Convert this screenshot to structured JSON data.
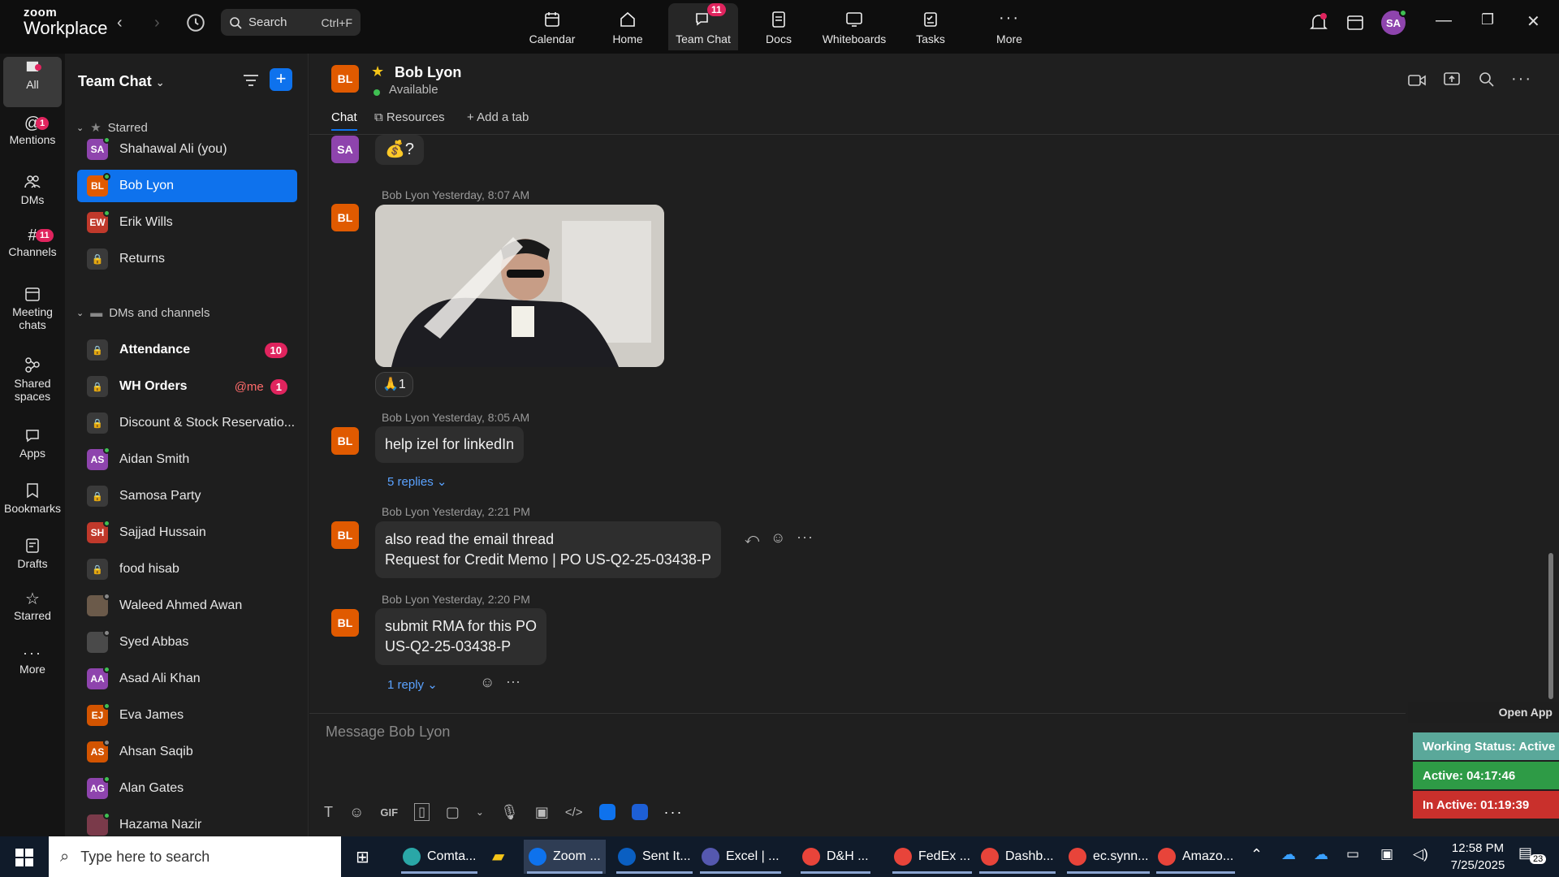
{
  "app": {
    "logo_top": "zoom",
    "logo_bottom": "Workplace",
    "search_label": "Search",
    "search_shortcut": "Ctrl+F"
  },
  "topnav": [
    {
      "label": "Calendar",
      "icon": "calendar-icon"
    },
    {
      "label": "Home",
      "icon": "home-icon"
    },
    {
      "label": "Team Chat",
      "icon": "chat-icon",
      "badge": "11"
    },
    {
      "label": "Docs",
      "icon": "docs-icon"
    },
    {
      "label": "Whiteboards",
      "icon": "whiteboard-icon"
    },
    {
      "label": "Tasks",
      "icon": "tasks-icon"
    },
    {
      "label": "More",
      "icon": "more-icon"
    }
  ],
  "user": {
    "initials": "SA"
  },
  "rail": [
    {
      "label": "All",
      "icon": "chat-bubble-icon"
    },
    {
      "label": "Mentions",
      "icon": "at-icon",
      "badge": "1"
    },
    {
      "label": "DMs",
      "icon": "people-icon"
    },
    {
      "label": "Channels",
      "icon": "hash-icon",
      "badge": "11"
    },
    {
      "label": "Meeting chats",
      "icon": "calendar-icon"
    },
    {
      "label": "Shared spaces",
      "icon": "shared-spaces-icon"
    },
    {
      "label": "Apps",
      "icon": "apps-icon"
    },
    {
      "label": "Bookmarks",
      "icon": "bookmark-icon"
    },
    {
      "label": "Drafts",
      "icon": "drafts-icon"
    },
    {
      "label": "Starred",
      "icon": "star-icon"
    },
    {
      "label": "More",
      "icon": "more-icon"
    }
  ],
  "sidebar": {
    "title": "Team Chat",
    "starred_label": "Starred",
    "dms_label": "DMs and channels",
    "starred": [
      {
        "name": "Shahawal Ali (you)",
        "initials": "SA",
        "color": "#8e44ad"
      },
      {
        "name": "Bob Lyon",
        "initials": "BL",
        "color": "#e05a00"
      },
      {
        "name": "Erik Wills",
        "initials": "EW",
        "color": "#c0392b"
      },
      {
        "name": "Returns",
        "initials": "",
        "color": "#3a3a3a"
      }
    ],
    "channels": [
      {
        "name": "Attendance",
        "count": "10",
        "bold": true
      },
      {
        "name": "WH Orders",
        "mention": "@me",
        "count": "1",
        "bold": true
      },
      {
        "name": "Discount & Stock Reservatio...",
        "count": ""
      },
      {
        "name": "Aidan Smith",
        "initials": "AS",
        "color": "#8e44ad"
      },
      {
        "name": "Samosa Party",
        "count": ""
      },
      {
        "name": "Sajjad Hussain",
        "initials": "SH",
        "color": "#c0392b"
      },
      {
        "name": "food hisab",
        "count": ""
      },
      {
        "name": "Waleed Ahmed Awan",
        "initials": "",
        "color": "#6b5a4a"
      },
      {
        "name": "Syed Abbas",
        "initials": "",
        "color": "#4a4a4a"
      },
      {
        "name": "Asad Ali Khan",
        "initials": "AA",
        "color": "#8e44ad"
      },
      {
        "name": "Eva James",
        "initials": "EJ",
        "color": "#d35400"
      },
      {
        "name": "Ahsan Saqib",
        "initials": "AS",
        "color": "#d35400"
      },
      {
        "name": "Alan Gates",
        "initials": "AG",
        "color": "#8e44ad"
      },
      {
        "name": "Hazama Nazir",
        "initials": "",
        "color": "#7a3a4a"
      }
    ]
  },
  "chat": {
    "contact_name": "Bob Lyon",
    "contact_initials": "BL",
    "status": "Available",
    "tabs": {
      "chat": "Chat",
      "resources": "Resources",
      "add": "Add a tab"
    },
    "first_sender_initials": "SA",
    "first_msg": "💰?",
    "messages": [
      {
        "meta": "Bob Lyon Yesterday, 8:07 AM",
        "reaction": "🙏1"
      },
      {
        "meta": "Bob Lyon Yesterday, 8:05 AM",
        "text": "help izel for linkedIn",
        "replies": "5 replies"
      },
      {
        "meta": "Bob Lyon Yesterday, 2:21 PM",
        "line1": "also read the email thread",
        "line2": "Request for Credit Memo | PO US-Q2-25-03438-P"
      },
      {
        "meta": "Bob Lyon Yesterday, 2:20 PM",
        "line1": "submit RMA for this PO",
        "line2": "US-Q2-25-03438-P",
        "replies": "1 reply"
      }
    ],
    "composer_placeholder": "Message Bob Lyon",
    "gif": "GIF"
  },
  "status_widget": {
    "open_app": "Open App",
    "working": "Working Status: Active",
    "active": "Active: 04:17:46",
    "inactive": "In Active: 01:19:39"
  },
  "taskbar": {
    "search_placeholder": "Type here to search",
    "apps": [
      "Comta...",
      "Zoom ...",
      "Sent It...",
      "Excel | ...",
      "D&H ...",
      "FedEx ...",
      "Dashb...",
      "ec.synn...",
      "Amazo..."
    ],
    "time": "12:58 PM",
    "date": "7/25/2025",
    "notif": "23"
  }
}
